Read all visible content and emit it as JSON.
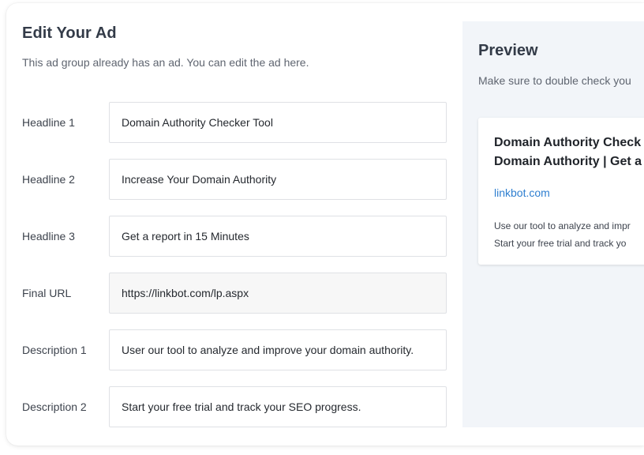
{
  "editor": {
    "title": "Edit Your Ad",
    "subtitle": "This ad group already has an ad. You can edit the ad here.",
    "fields": [
      {
        "label": "Headline 1",
        "value": "Domain Authority Checker Tool"
      },
      {
        "label": "Headline 2",
        "value": "Increase Your Domain Authority"
      },
      {
        "label": "Headline 3",
        "value": "Get a report in 15 Minutes"
      },
      {
        "label": "Final URL",
        "value": "https://linkbot.com/lp.aspx"
      },
      {
        "label": "Description 1",
        "value": "User our tool to analyze and improve your domain authority."
      },
      {
        "label": "Description 2",
        "value": "Start your free trial and track your SEO progress."
      }
    ]
  },
  "preview": {
    "title": "Preview",
    "subtitle": "Make sure to double check you",
    "ad": {
      "headline_line1": "Domain Authority Check",
      "headline_line2": "Domain Authority | Get a",
      "display_url": "linkbot.com",
      "description_line1": "Use our tool to analyze and impr",
      "description_line2": "Start your free trial and track yo"
    }
  },
  "colors": {
    "accent_link": "#2f7fd0",
    "preview_background": "#f2f5f9",
    "readonly_field_background": "#f7f7f7"
  }
}
